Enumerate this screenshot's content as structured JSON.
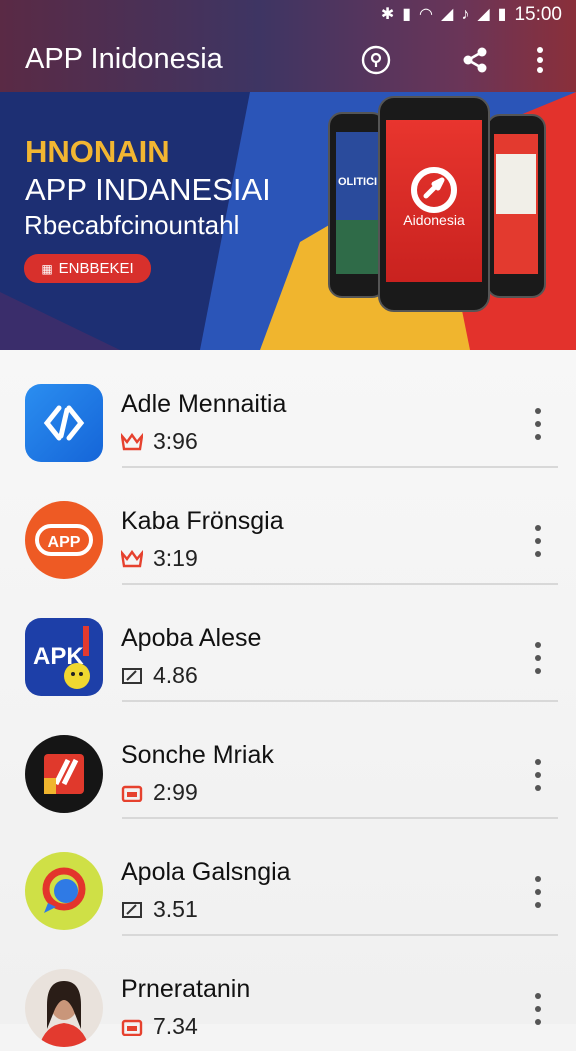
{
  "status_bar": {
    "time": "15:00"
  },
  "app_bar": {
    "title": "APP Inidonesia",
    "actions": [
      "info-icon",
      "share-icon",
      "more-vert-icon"
    ]
  },
  "banner": {
    "kicker": "HNONAIN",
    "title": "APP INDANESIAI",
    "subtitle": "Rbecabfcinountahl",
    "button_label": "ENBBEKEI",
    "phone_left_text": "OLITICI",
    "phone_center_text": "Aidonesia"
  },
  "apps": [
    {
      "name": "Adle Mennaitia",
      "value": "3:96",
      "meta_icon": "crown-icon",
      "accent": "#e6412e"
    },
    {
      "name": "Kaba Frönsgia",
      "value": "3:19",
      "meta_icon": "crown-icon",
      "accent": "#e6412e"
    },
    {
      "name": "Apoba Alese",
      "value": "4.86",
      "meta_icon": "edit-icon",
      "accent": "#333333"
    },
    {
      "name": "Sonche Mriak",
      "value": "2:99",
      "meta_icon": "calendar-icon",
      "accent": "#e6412e"
    },
    {
      "name": "Apola Galsngia",
      "value": "3.51",
      "meta_icon": "edit-icon",
      "accent": "#333333"
    },
    {
      "name": "Prneratanin",
      "value": "7.34",
      "meta_icon": "calendar-icon",
      "accent": "#e6412e"
    }
  ]
}
